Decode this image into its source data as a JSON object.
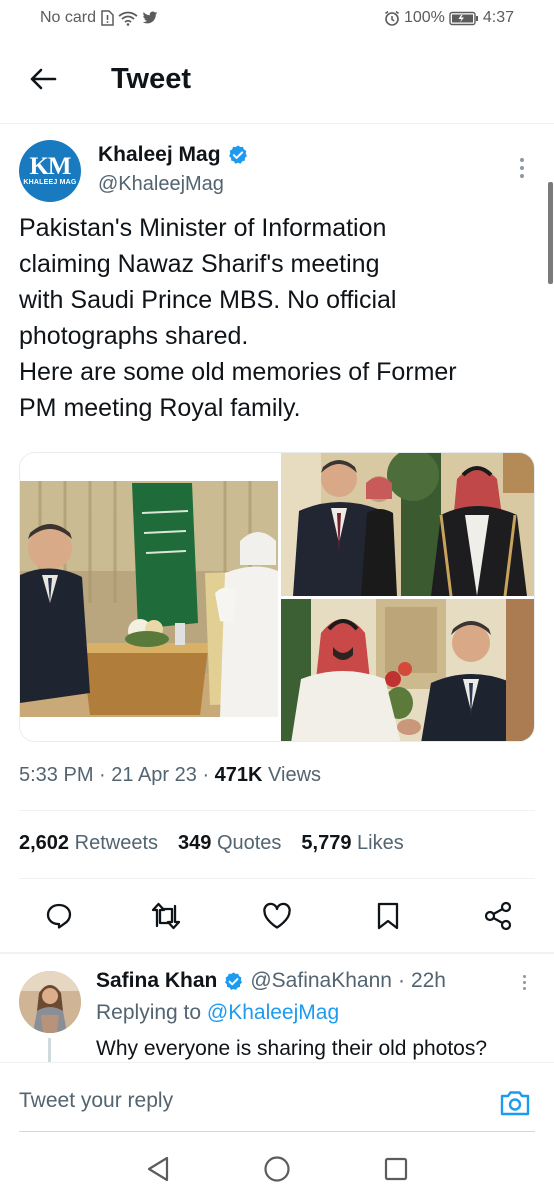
{
  "status_bar": {
    "carrier": "No card",
    "battery": "100%",
    "time": "4:37"
  },
  "header": {
    "title": "Tweet"
  },
  "tweet": {
    "avatar_text": "KM",
    "avatar_subtext": "KHALEEJ MAG",
    "author_name": "Khaleej Mag",
    "author_handle": "@KhaleejMag",
    "text_lines": [
      "Pakistan's Minister of Information",
      "claiming Nawaz Sharif's meeting",
      "with Saudi Prince MBS. No official",
      "photographs shared.",
      "Here are some old memories of Former",
      "PM meeting Royal family."
    ],
    "time": "5:33 PM",
    "date": "21 Apr 23",
    "views_count": "471K",
    "views_label": "Views",
    "retweets_count": "2,602",
    "retweets_label": "Retweets",
    "quotes_count": "349",
    "quotes_label": "Quotes",
    "likes_count": "5,779",
    "likes_label": "Likes"
  },
  "actions": [
    "reply-icon",
    "retweet-icon",
    "like-icon",
    "bookmark-icon",
    "share-icon"
  ],
  "reply": {
    "name": "Safina Khan",
    "handle": "@SafinaKhann",
    "age": "22h",
    "replying_prefix": "Replying to",
    "replying_to": "@KhaleejMag",
    "text": "Why everyone is sharing their old photos?"
  },
  "composer": {
    "placeholder": "Tweet your reply"
  },
  "colors": {
    "accent": "#1d9bf0",
    "text_primary": "#0f1419",
    "text_secondary": "#536471",
    "verified": "#1d9bf0",
    "km_avatar": "#1a7abf"
  }
}
